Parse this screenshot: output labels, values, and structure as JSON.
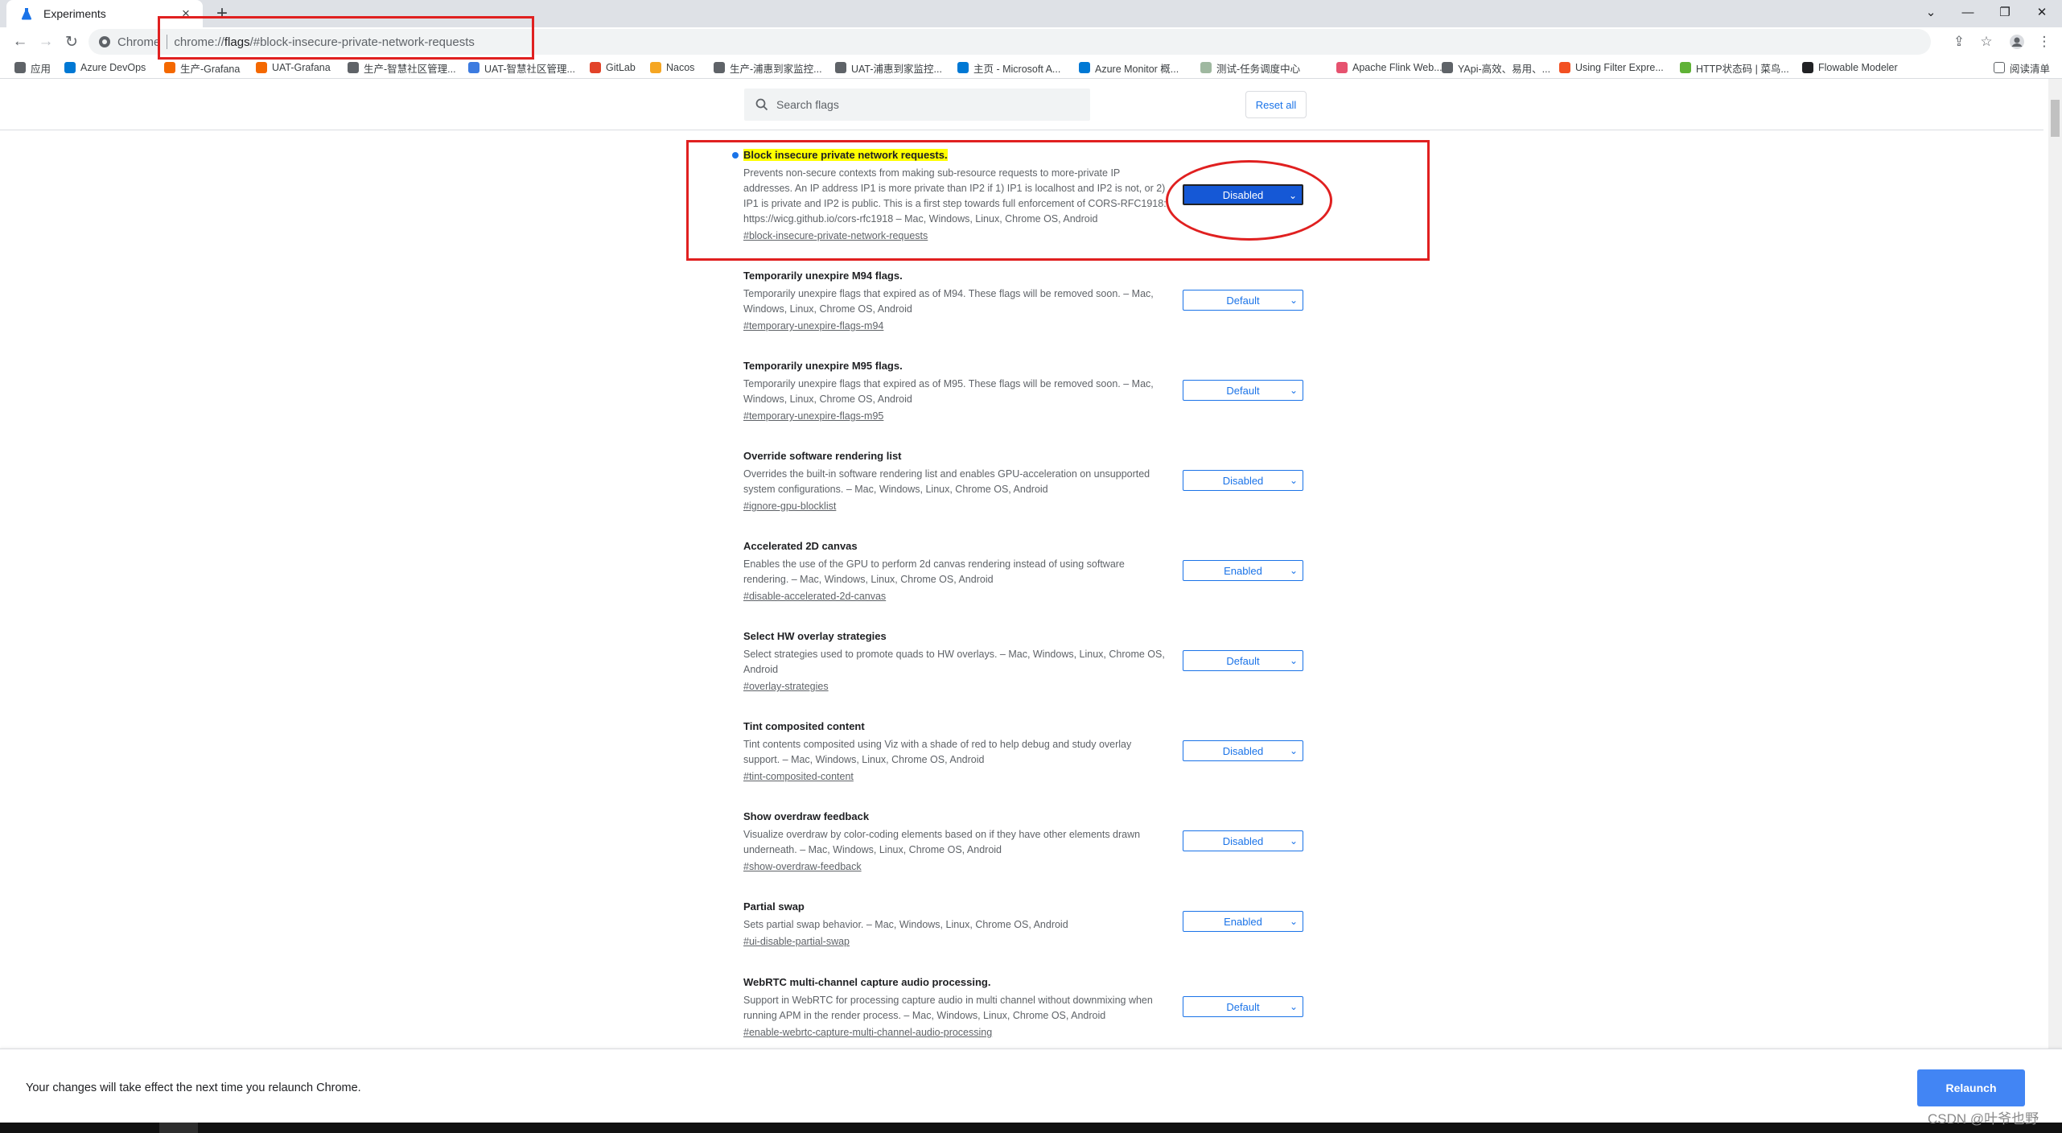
{
  "browser": {
    "tab_title": "Experiments",
    "omnibox_site": "Chrome",
    "url_prefix": "chrome://",
    "url_host": "flags",
    "url_rest": "/#block-insecure-private-network-requests"
  },
  "bookmarks": [
    {
      "label": "应用",
      "color": "#5f6368"
    },
    {
      "label": "Azure DevOps",
      "color": "#0078d4"
    },
    {
      "label": "生产-Grafana",
      "color": "#f46800"
    },
    {
      "label": "UAT-Grafana",
      "color": "#f46800"
    },
    {
      "label": "生产-智慧社区管理...",
      "color": "#5f6368"
    },
    {
      "label": "UAT-智慧社区管理...",
      "color": "#3c7be0"
    },
    {
      "label": "GitLab",
      "color": "#e24329"
    },
    {
      "label": "Nacos",
      "color": "#f5a623"
    },
    {
      "label": "生产-浦惠到家监控...",
      "color": "#5f6368"
    },
    {
      "label": "UAT-浦惠到家监控...",
      "color": "#5f6368"
    },
    {
      "label": "主页 - Microsoft A...",
      "color": "#0078d4"
    },
    {
      "label": "Azure Monitor 概...",
      "color": "#0078d4"
    },
    {
      "label": "测试-任务调度中心",
      "color": "#9fb8a0"
    },
    {
      "label": "Apache Flink Web...",
      "color": "#e6526f"
    },
    {
      "label": "YApi-高效、易用、...",
      "color": "#5f6368"
    },
    {
      "label": "Using Filter Expre...",
      "color": "#f25022"
    },
    {
      "label": "HTTP状态码 | 菜鸟...",
      "color": "#5fb236"
    },
    {
      "label": "Flowable Modeler",
      "color": "#202124"
    }
  ],
  "reading_list": "阅读清单",
  "search": {
    "placeholder": "Search flags"
  },
  "reset_all": "Reset all",
  "experiments": [
    {
      "name": "Block insecure private network requests.",
      "description": "Prevents non-secure contexts from making sub-resource requests to more-private IP addresses. An IP address IP1 is more private than IP2 if 1) IP1 is localhost and IP2 is not, or 2) IP1 is private and IP2 is public. This is a first step towards full enforcement of CORS-RFC1918: https://wicg.github.io/cors-rfc1918 – Mac, Windows, Linux, Chrome OS, Android",
      "link": "#block-insecure-private-network-requests",
      "value": "Disabled",
      "highlighted": true
    },
    {
      "name": "Temporarily unexpire M94 flags.",
      "description": "Temporarily unexpire flags that expired as of M94. These flags will be removed soon. – Mac, Windows, Linux, Chrome OS, Android",
      "link": "#temporary-unexpire-flags-m94",
      "value": "Default"
    },
    {
      "name": "Temporarily unexpire M95 flags.",
      "description": "Temporarily unexpire flags that expired as of M95. These flags will be removed soon. – Mac, Windows, Linux, Chrome OS, Android",
      "link": "#temporary-unexpire-flags-m95",
      "value": "Default"
    },
    {
      "name": "Override software rendering list",
      "description": "Overrides the built-in software rendering list and enables GPU-acceleration on unsupported system configurations. – Mac, Windows, Linux, Chrome OS, Android",
      "link": "#ignore-gpu-blocklist",
      "value": "Disabled"
    },
    {
      "name": "Accelerated 2D canvas",
      "description": "Enables the use of the GPU to perform 2d canvas rendering instead of using software rendering. – Mac, Windows, Linux, Chrome OS, Android",
      "link": "#disable-accelerated-2d-canvas",
      "value": "Enabled"
    },
    {
      "name": "Select HW overlay strategies",
      "description": "Select strategies used to promote quads to HW overlays. – Mac, Windows, Linux, Chrome OS, Android",
      "link": "#overlay-strategies",
      "value": "Default"
    },
    {
      "name": "Tint composited content",
      "description": "Tint contents composited using Viz with a shade of red to help debug and study overlay support. – Mac, Windows, Linux, Chrome OS, Android",
      "link": "#tint-composited-content",
      "value": "Disabled"
    },
    {
      "name": "Show overdraw feedback",
      "description": "Visualize overdraw by color-coding elements based on if they have other elements drawn underneath. – Mac, Windows, Linux, Chrome OS, Android",
      "link": "#show-overdraw-feedback",
      "value": "Disabled"
    },
    {
      "name": "Partial swap",
      "description": "Sets partial swap behavior. – Mac, Windows, Linux, Chrome OS, Android",
      "link": "#ui-disable-partial-swap",
      "value": "Enabled"
    },
    {
      "name": "WebRTC multi-channel capture audio processing.",
      "description": "Support in WebRTC for processing capture audio in multi channel without downmixing when running APM in the render process. – Mac, Windows, Linux, Chrome OS, Android",
      "link": "#enable-webrtc-capture-multi-channel-audio-processing",
      "value": "Default"
    }
  ],
  "footer": {
    "message": "Your changes will take effect the next time you relaunch Chrome.",
    "relaunch": "Relaunch"
  },
  "watermark": "CSDN @叶爷也野"
}
